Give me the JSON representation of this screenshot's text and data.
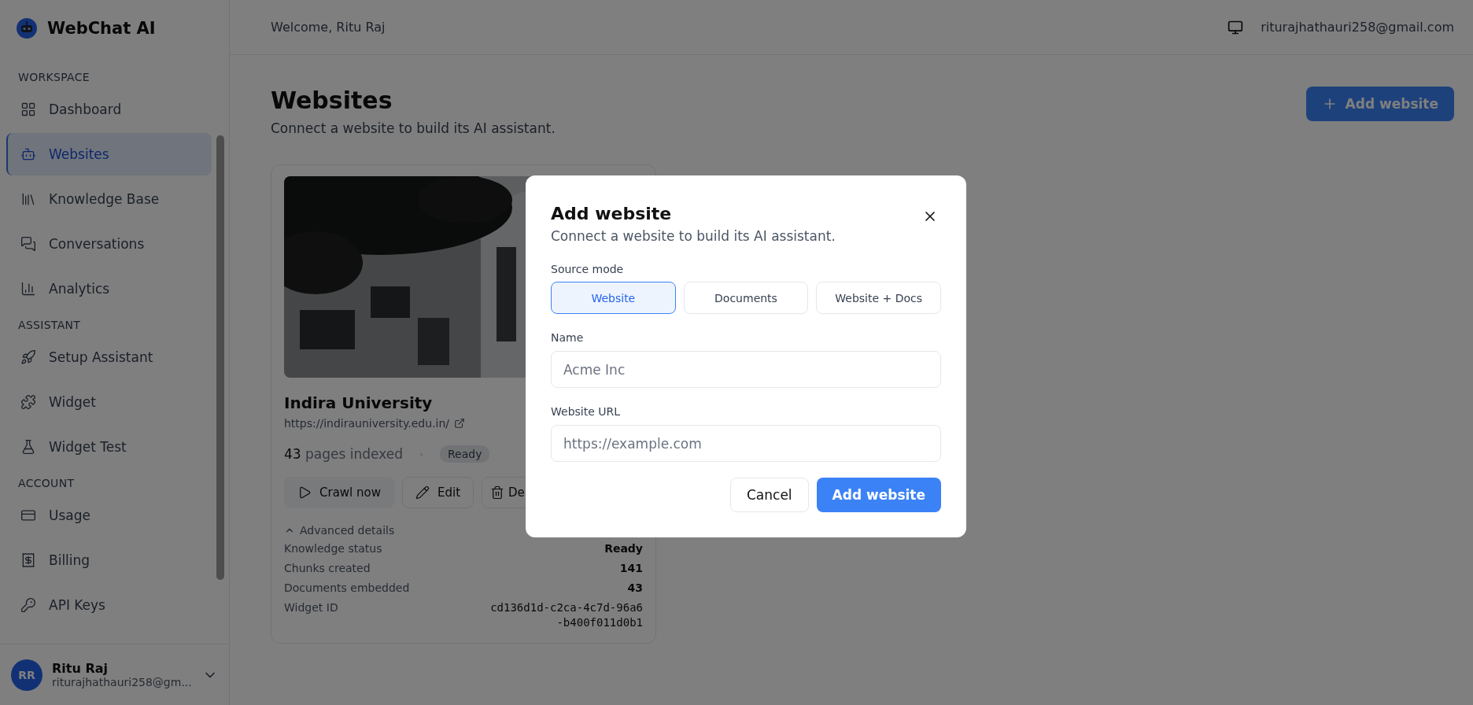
{
  "sidebar": {
    "brand": "WebChat AI",
    "sections": [
      {
        "label": "WORKSPACE",
        "items": [
          {
            "label": "Dashboard",
            "selected": false
          },
          {
            "label": "Websites",
            "selected": true
          },
          {
            "label": "Knowledge Base",
            "selected": false
          },
          {
            "label": "Conversations",
            "selected": false
          },
          {
            "label": "Analytics",
            "selected": false
          }
        ]
      },
      {
        "label": "ASSISTANT",
        "items": [
          {
            "label": "Setup Assistant",
            "selected": false
          },
          {
            "label": "Widget",
            "selected": false
          },
          {
            "label": "Widget Test",
            "selected": false
          }
        ]
      },
      {
        "label": "ACCOUNT",
        "items": [
          {
            "label": "Usage",
            "selected": false
          },
          {
            "label": "Billing",
            "selected": false
          },
          {
            "label": "API Keys",
            "selected": false
          }
        ]
      }
    ],
    "user": {
      "initials": "RR",
      "name": "Ritu Raj",
      "email": "riturajhathauri258@gm..."
    }
  },
  "topbar": {
    "welcome": "Welcome, Ritu Raj",
    "email": "riturajhathauri258@gmail.com"
  },
  "page": {
    "title": "Websites",
    "subtitle": "Connect a website to build its AI assistant.",
    "add_button": "Add website"
  },
  "card": {
    "name": "Indira University",
    "url": "https://indirauniversity.edu.in/",
    "pages_count": "43",
    "pages_label": "pages indexed",
    "status": "Ready",
    "actions": [
      {
        "kind": "crawl",
        "label": "Crawl now"
      },
      {
        "kind": "edit",
        "label": "Edit"
      },
      {
        "kind": "delete",
        "label": "De"
      }
    ],
    "advanced_label": "Advanced details",
    "expanded": true,
    "details": [
      {
        "label": "Knowledge status",
        "value_lines": [
          "Ready"
        ],
        "kind": "text"
      },
      {
        "label": "Chunks created",
        "value_lines": [
          "141"
        ],
        "kind": "text"
      },
      {
        "label": "Documents embedded",
        "value_lines": [
          "43"
        ],
        "kind": "text"
      },
      {
        "label": "Widget ID",
        "value_lines": [
          "cd136d1d-c2ca-4c7d-96a6",
          "-b400f011d0b1"
        ],
        "kind": "mono"
      }
    ]
  },
  "dialog": {
    "title": "Add website",
    "subtitle": "Connect a website to build its AI assistant.",
    "source_label": "Source mode",
    "modes": [
      {
        "label": "Website",
        "selected": true
      },
      {
        "label": "Documents",
        "selected": false
      },
      {
        "label": "Website + Docs",
        "selected": false
      }
    ],
    "fields": [
      {
        "label": "Name",
        "placeholder": "Acme Inc"
      },
      {
        "label": "Website URL",
        "placeholder": "https://example.com"
      }
    ],
    "cancel": "Cancel",
    "submit": "Add website"
  }
}
